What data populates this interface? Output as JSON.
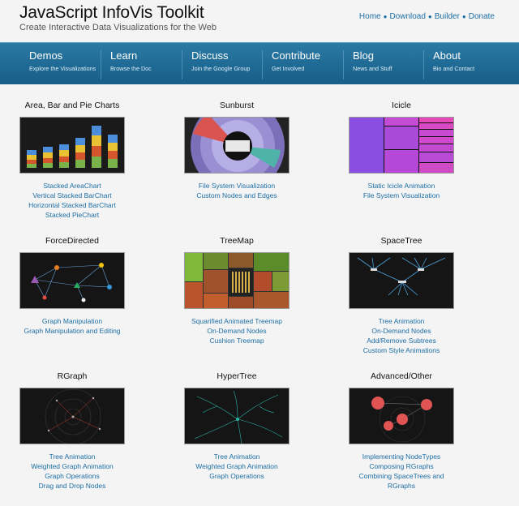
{
  "header": {
    "title": "JavaScript InfoVis Toolkit",
    "tagline": "Create Interactive Data Visualizations for the Web",
    "links": [
      "Home",
      "Download",
      "Builder",
      "Donate"
    ]
  },
  "nav": [
    {
      "title": "Demos",
      "sub": "Explore the Visualizations"
    },
    {
      "title": "Learn",
      "sub": "Browse the Doc"
    },
    {
      "title": "Discuss",
      "sub": "Join the Google Group"
    },
    {
      "title": "Contribute",
      "sub": "Get Involved"
    },
    {
      "title": "Blog",
      "sub": "News and Stuff"
    },
    {
      "title": "About",
      "sub": "Bio and Contact"
    }
  ],
  "gallery": [
    {
      "title": "Area, Bar and Pie Charts",
      "links": [
        "Stacked AreaChart",
        "Vertical Stacked BarChart",
        "Horizontal Stacked BarChart",
        "Stacked PieChart"
      ]
    },
    {
      "title": "Sunburst",
      "links": [
        "File System Visualization",
        "Custom Nodes and Edges"
      ]
    },
    {
      "title": "Icicle",
      "links": [
        "Static Icicle Animation",
        "File System Visualization"
      ]
    },
    {
      "title": "ForceDirected",
      "links": [
        "Graph Manipulation",
        "Graph Manipulation and Editing"
      ]
    },
    {
      "title": "TreeMap",
      "links": [
        "Squarified Animated Treemap",
        "On-Demand Nodes",
        "Cushion Treemap"
      ]
    },
    {
      "title": "SpaceTree",
      "links": [
        "Tree Animation",
        "On-Demand Nodes",
        "Add/Remove Subtrees",
        "Custom Style Animations"
      ]
    },
    {
      "title": "RGraph",
      "links": [
        "Tree Animation",
        "Weighted Graph Animation",
        "Graph Operations",
        "Drag and Drop Nodes"
      ]
    },
    {
      "title": "HyperTree",
      "links": [
        "Tree Animation",
        "Weighted Graph Animation",
        "Graph Operations"
      ]
    },
    {
      "title": "Advanced/Other",
      "links": [
        "Implementing NodeTypes",
        "Composing RGraphs",
        "Combining SpaceTrees and",
        "RGraphs"
      ]
    }
  ]
}
